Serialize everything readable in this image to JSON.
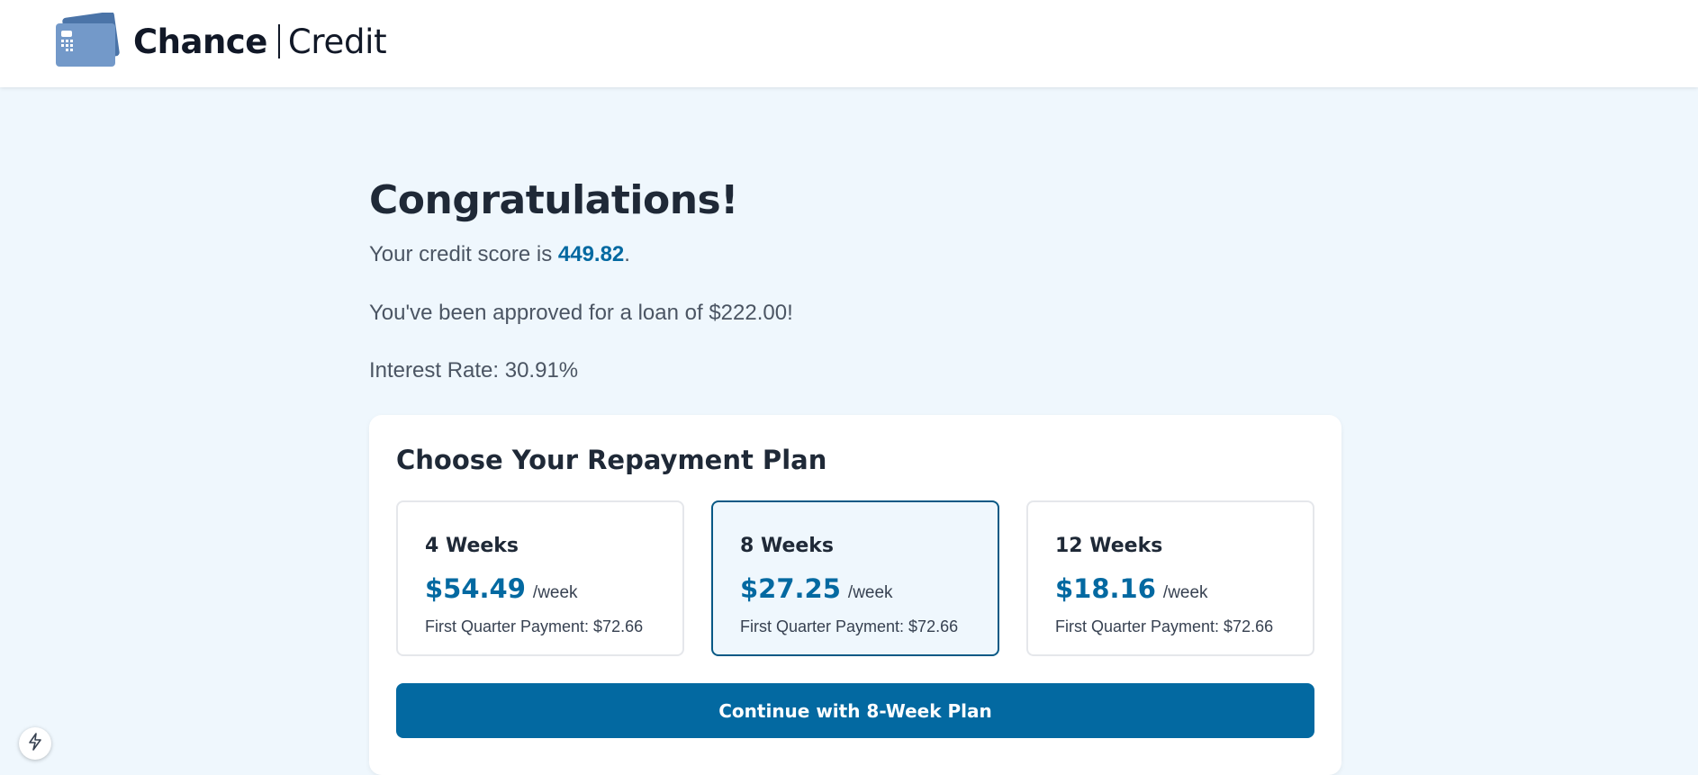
{
  "brand": {
    "name_bold": "Chance",
    "name_light": "Credit",
    "logo_icon": "credit-card-icon",
    "colors": {
      "primary": "#0369a1",
      "logo_card": "#6b93c5"
    }
  },
  "result": {
    "title": "Congratulations!",
    "score_prefix": "Your credit score is ",
    "score_value": "449.82",
    "score_suffix": ".",
    "approval_text": "You've been approved for a loan of $222.00!",
    "interest_text": "Interest Rate: 30.91%"
  },
  "plans_card": {
    "title": "Choose Your Repayment Plan",
    "plans": [
      {
        "name": "4 Weeks",
        "price": "$54.49",
        "unit": "/week",
        "first_payment": "First Quarter Payment: $72.66",
        "selected": false
      },
      {
        "name": "8 Weeks",
        "price": "$27.25",
        "unit": "/week",
        "first_payment": "First Quarter Payment: $72.66",
        "selected": true
      },
      {
        "name": "12 Weeks",
        "price": "$18.16",
        "unit": "/week",
        "first_payment": "First Quarter Payment: $72.66",
        "selected": false
      }
    ],
    "continue_label": "Continue with 8-Week Plan"
  },
  "dev_badge": {
    "icon": "lightning-icon"
  }
}
